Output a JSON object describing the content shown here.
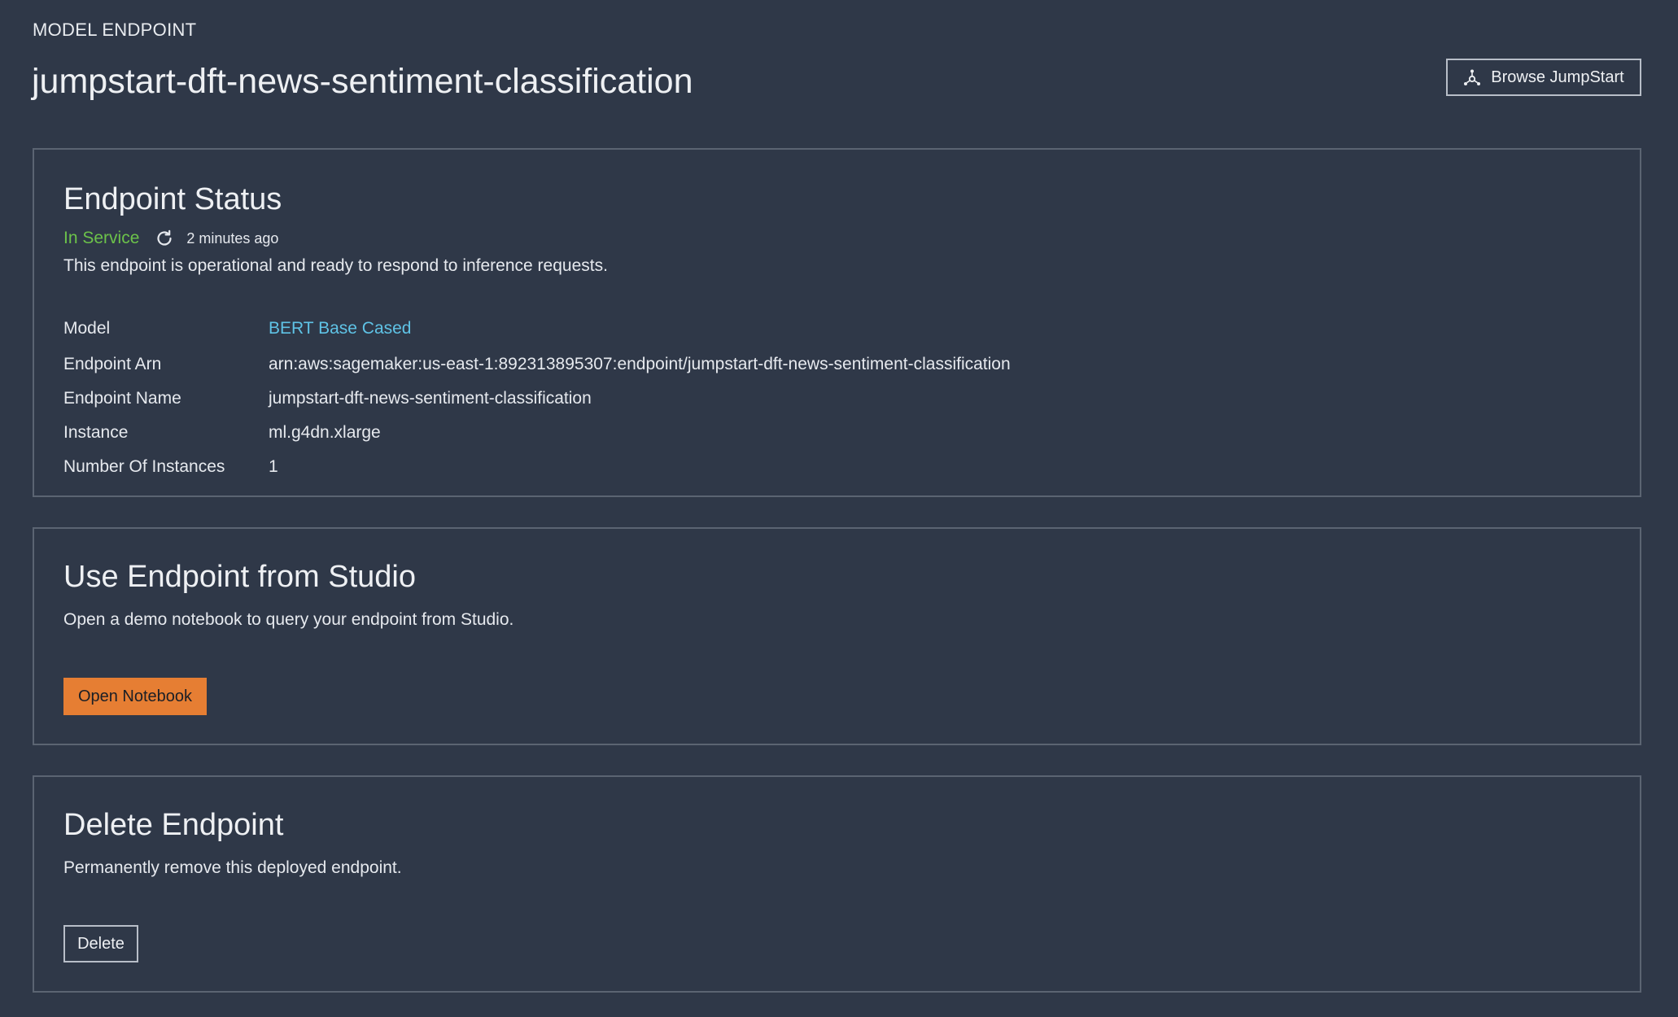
{
  "header": {
    "eyebrow": "MODEL ENDPOINT",
    "title": "jumpstart-dft-news-sentiment-classification",
    "browse_button": {
      "label": "Browse JumpStart",
      "icon": "jumpstart-network-icon"
    }
  },
  "status_card": {
    "heading": "Endpoint Status",
    "status": "In Service",
    "status_color": "#6cc24a",
    "refresh_icon": "refresh-icon",
    "updated": "2 minutes ago",
    "description": "This endpoint is operational and ready to respond to inference requests.",
    "details": [
      {
        "label": "Model",
        "value": "BERT Base Cased",
        "is_link": true
      },
      {
        "label": "Endpoint Arn",
        "value": "arn:aws:sagemaker:us-east-1:892313895307:endpoint/jumpstart-dft-news-sentiment-classification"
      },
      {
        "label": "Endpoint Name",
        "value": "jumpstart-dft-news-sentiment-classification"
      },
      {
        "label": "Instance",
        "value": "ml.g4dn.xlarge"
      },
      {
        "label": "Number Of Instances",
        "value": "1"
      }
    ]
  },
  "studio_card": {
    "heading": "Use Endpoint from Studio",
    "description": "Open a demo notebook to query your endpoint from Studio.",
    "button_label": "Open Notebook",
    "button_color": "#e67e33"
  },
  "delete_card": {
    "heading": "Delete Endpoint",
    "description": "Permanently remove this deployed endpoint.",
    "button_label": "Delete"
  },
  "colors": {
    "background": "#2f3848",
    "link": "#5fc3e6",
    "border": "#5b6472"
  }
}
